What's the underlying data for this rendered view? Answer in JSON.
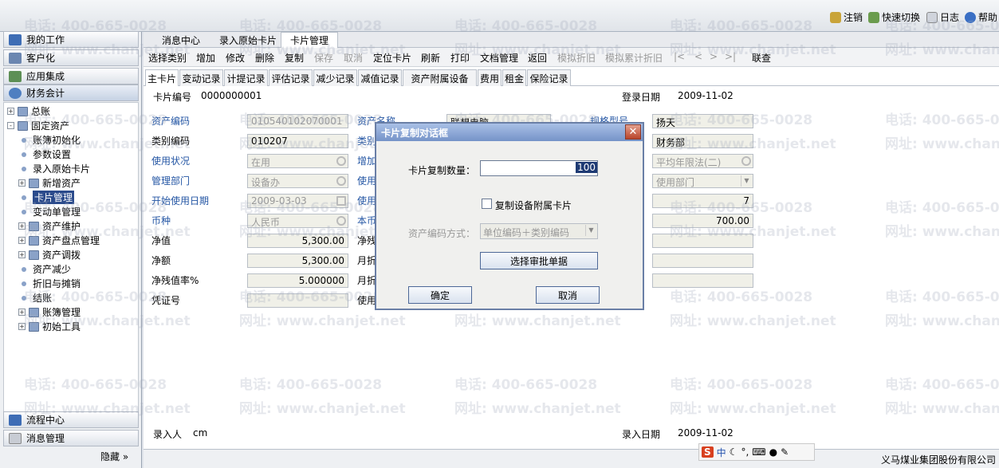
{
  "topbar": {
    "logout": "注销",
    "quick_switch": "快速切换",
    "log": "日志",
    "help": "帮助"
  },
  "nav": {
    "headers": [
      "我的工作",
      "客户化",
      "应用集成",
      "财务会计"
    ],
    "bottom": [
      "流程中心",
      "消息管理"
    ],
    "hide": "隐藏",
    "tree": [
      {
        "label": "总账",
        "type": "folder",
        "level": 0,
        "exp": "+"
      },
      {
        "label": "固定资产",
        "type": "folder",
        "level": 0,
        "exp": "-"
      },
      {
        "label": "账簿初始化",
        "type": "leaf",
        "level": 1
      },
      {
        "label": "参数设置",
        "type": "leaf",
        "level": 1
      },
      {
        "label": "录入原始卡片",
        "type": "leaf",
        "level": 1
      },
      {
        "label": "新增资产",
        "type": "folder",
        "level": 1,
        "exp": "+"
      },
      {
        "label": "卡片管理",
        "type": "leaf",
        "level": 1,
        "selected": true
      },
      {
        "label": "变动单管理",
        "type": "leaf",
        "level": 1
      },
      {
        "label": "资产维护",
        "type": "folder",
        "level": 1,
        "exp": "+"
      },
      {
        "label": "资产盘点管理",
        "type": "folder",
        "level": 1,
        "exp": "+"
      },
      {
        "label": "资产调拨",
        "type": "folder",
        "level": 1,
        "exp": "+"
      },
      {
        "label": "资产减少",
        "type": "leaf",
        "level": 1
      },
      {
        "label": "折旧与摊销",
        "type": "leaf",
        "level": 1
      },
      {
        "label": "结账",
        "type": "leaf",
        "level": 1
      },
      {
        "label": "账簿管理",
        "type": "folder",
        "level": 1,
        "exp": "+"
      },
      {
        "label": "初始工具",
        "type": "folder",
        "level": 1,
        "exp": "+"
      }
    ]
  },
  "tabs": [
    "消息中心",
    "录入原始卡片",
    "卡片管理"
  ],
  "toolbar": [
    {
      "label": "选择类别",
      "enabled": true
    },
    {
      "label": "增加",
      "enabled": true
    },
    {
      "label": "修改",
      "enabled": true
    },
    {
      "label": "删除",
      "enabled": true
    },
    {
      "label": "复制",
      "enabled": true
    },
    {
      "label": "保存",
      "enabled": false
    },
    {
      "label": "取消",
      "enabled": false
    },
    {
      "label": "定位卡片",
      "enabled": true
    },
    {
      "label": "刷新",
      "enabled": true
    },
    {
      "label": "打印",
      "enabled": true
    },
    {
      "label": "文档管理",
      "enabled": true
    },
    {
      "label": "返回",
      "enabled": true
    },
    {
      "label": "模拟折旧",
      "enabled": false
    },
    {
      "label": "模拟累计折旧",
      "enabled": false
    },
    {
      "label": "|<",
      "enabled": false
    },
    {
      "label": "<",
      "enabled": false
    },
    {
      "label": ">",
      "enabled": false
    },
    {
      "label": ">|",
      "enabled": false
    },
    {
      "label": "联查",
      "enabled": true
    }
  ],
  "subtabs": [
    "主卡片",
    "变动记录",
    "计提记录",
    "评估记录",
    "减少记录",
    "减值记录",
    "资产附属设备",
    "费用",
    "租金",
    "保险记录"
  ],
  "form": {
    "card_no_label": "卡片编号",
    "card_no": "0000000001",
    "login_date_label": "登录日期",
    "login_date": "2009-11-02",
    "asset_code_label": "资产编码",
    "asset_code": "010540102070001",
    "category_code_label": "类别编码",
    "category_code": "010207",
    "status_label": "使用状况",
    "status": "在用",
    "dept_label": "管理部门",
    "dept": "设备办",
    "start_date_label": "开始使用日期",
    "start_date": "2009-03-03",
    "currency_label": "币种",
    "currency": "人民币",
    "net_value_label": "净值",
    "net_value": "5,300.00",
    "net_amount_label": "净额",
    "net_amount": "5,300.00",
    "residual_rate_label": "净残值率%",
    "residual_rate": "5.000000",
    "voucher_label": "凭证号",
    "voucher": "",
    "mid_labels": [
      "资产名称",
      "类别",
      "增加",
      "使用",
      "使用",
      "本币",
      "净残",
      "月折",
      "月折",
      "使用"
    ],
    "mid_value_partial": "联想电脑",
    "spec_label": "规格型号",
    "right_values": [
      "扬天",
      "财务部",
      "平均年限法(二)",
      "使用部门",
      "7",
      "700.00",
      "",
      "",
      ""
    ],
    "entry_person_label": "录入人",
    "entry_person": "cm",
    "entry_date_label": "录入日期",
    "entry_date": "2009-11-02"
  },
  "dialog": {
    "title": "卡片复制对话框",
    "close": "✕",
    "qty_label": "卡片复制数量：",
    "qty": "100",
    "copy_equipment": "复制设备附属卡片",
    "code_mode_label": "资产编码方式：",
    "code_mode": "单位编码＋类别编码",
    "select_btn": "选择审批单据",
    "ok": "确定",
    "cancel": "取消"
  },
  "ime": {
    "s": "S",
    "zh": "中"
  },
  "company": "义马煤业集团股份有限公司",
  "watermark": {
    "phone": "电话: 400-665-0028",
    "site": "网址: www.chanjet.net"
  }
}
